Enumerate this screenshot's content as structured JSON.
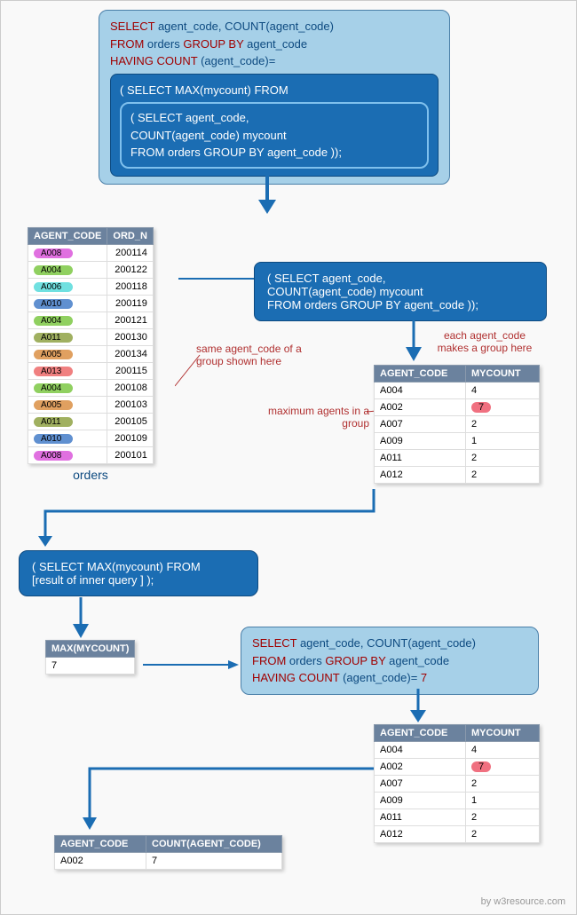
{
  "mainQuery": {
    "l1a": "SELECT",
    "l1b": " agent_code, COUNT(agent_code)",
    "l2a": "FROM",
    "l2b": " orders ",
    "l2c": "GROUP BY",
    "l2d": " agent_code",
    "l3a": "HAVING COUNT",
    "l3b": " (agent_code)=",
    "mid": "( SELECT MAX(mycount)  FROM",
    "in1": "( SELECT agent_code,",
    "in2": "COUNT(agent_code) mycount",
    "in3": "FROM orders  GROUP BY agent_code ));"
  },
  "ordersTable": {
    "h1": "AGENT_CODE",
    "h2": "ORD_N",
    "rows": [
      {
        "code": "A008",
        "ord": "200114",
        "cls": "p-magenta"
      },
      {
        "code": "A004",
        "ord": "200122",
        "cls": "p-green"
      },
      {
        "code": "A006",
        "ord": "200118",
        "cls": "p-cyan"
      },
      {
        "code": "A010",
        "ord": "200119",
        "cls": "p-blue"
      },
      {
        "code": "A004",
        "ord": "200121",
        "cls": "p-green"
      },
      {
        "code": "A011",
        "ord": "200130",
        "cls": "p-olive"
      },
      {
        "code": "A005",
        "ord": "200134",
        "cls": "p-orange"
      },
      {
        "code": "A013",
        "ord": "200115",
        "cls": "p-salmon"
      },
      {
        "code": "A004",
        "ord": "200108",
        "cls": "p-green"
      },
      {
        "code": "A005",
        "ord": "200103",
        "cls": "p-orange"
      },
      {
        "code": "A011",
        "ord": "200105",
        "cls": "p-olive"
      },
      {
        "code": "A010",
        "ord": "200109",
        "cls": "p-blue"
      },
      {
        "code": "A008",
        "ord": "200101",
        "cls": "p-magenta"
      }
    ],
    "caption": "orders"
  },
  "subquery1": {
    "l1": "( SELECT agent_code,",
    "l2": "COUNT(agent_code) mycount",
    "l3": "FROM orders  GROUP BY agent_code ));"
  },
  "annot1": "same agent_code of a group shown here",
  "annot2": "each agent_code makes a group here",
  "annot3": "maximum agents in a group",
  "countTable": {
    "h1": "AGENT_CODE",
    "h2": "MYCOUNT",
    "rows": [
      {
        "code": "A004",
        "n": "4",
        "hl": false
      },
      {
        "code": "A002",
        "n": "7",
        "hl": true
      },
      {
        "code": "A007",
        "n": "2",
        "hl": false
      },
      {
        "code": "A009",
        "n": "1",
        "hl": false
      },
      {
        "code": "A011",
        "n": "2",
        "hl": false
      },
      {
        "code": "A012",
        "n": "2",
        "hl": false
      }
    ]
  },
  "midQuery": {
    "l1": "( SELECT MAX(mycount)  FROM",
    "l2": "[result of inner query ] );"
  },
  "maxTable": {
    "h": "MAX(MYCOUNT)",
    "v": "7"
  },
  "finalQuery": {
    "l1a": "SELECT",
    "l1b": " agent_code, COUNT(agent_code)",
    "l2a": "FROM",
    "l2b": " orders ",
    "l2c": "GROUP BY",
    "l2d": " agent_code",
    "l3a": "HAVING COUNT",
    "l3b": " (agent_code)=",
    "l3c": " 7"
  },
  "resultTable": {
    "h1": "AGENT_CODE",
    "h2": "COUNT(AGENT_CODE)",
    "rows": [
      {
        "code": "A002",
        "n": "7"
      }
    ]
  },
  "watermark": "by w3resource.com"
}
